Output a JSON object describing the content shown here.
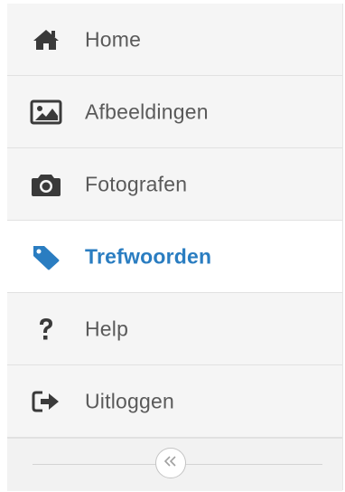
{
  "sidebar": {
    "items": [
      {
        "label": "Home",
        "icon": "home-icon",
        "active": false
      },
      {
        "label": "Afbeeldingen",
        "icon": "image-icon",
        "active": false
      },
      {
        "label": "Fotografen",
        "icon": "camera-icon",
        "active": false
      },
      {
        "label": "Trefwoorden",
        "icon": "tag-icon",
        "active": true
      },
      {
        "label": "Help",
        "icon": "question-icon",
        "active": false
      },
      {
        "label": "Uitloggen",
        "icon": "sign-out-icon",
        "active": false
      }
    ],
    "collapse_icon": "double-chevron-left-icon"
  },
  "colors": {
    "accent": "#2a7dc1",
    "text": "#5a5a5a",
    "icon": "#3a3a3a",
    "sidebar_bg": "#f5f5f5",
    "active_bg": "#ffffff"
  }
}
